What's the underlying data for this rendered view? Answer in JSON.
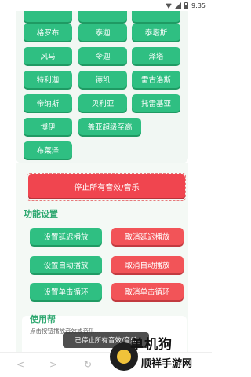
{
  "status_bar": {
    "time": "9:35",
    "icons": [
      "wifi-icon",
      "signal-icon",
      "battery-icon"
    ]
  },
  "grid_buttons": [
    {
      "label": ""
    },
    {
      "label": ""
    },
    {
      "label": ""
    },
    {
      "label": "格罗布"
    },
    {
      "label": "泰迦"
    },
    {
      "label": "泰塔斯"
    },
    {
      "label": "风马"
    },
    {
      "label": "令迦"
    },
    {
      "label": "泽塔"
    },
    {
      "label": "特利迦"
    },
    {
      "label": "德凯"
    },
    {
      "label": "雷古洛斯"
    },
    {
      "label": "帝纳斯"
    },
    {
      "label": "贝利亚"
    },
    {
      "label": "托雷基亚"
    },
    {
      "label": "博伊"
    },
    {
      "label": "盖亚超级至高"
    },
    {
      "label": "布莱泽"
    }
  ],
  "stop_all": {
    "label": "停止所有音效/音乐"
  },
  "function_settings": {
    "title": "功能设置",
    "rows": [
      {
        "set_label": "设置延迟播放",
        "cancel_label": "取消延迟播放"
      },
      {
        "set_label": "设置自动播放",
        "cancel_label": "取消自动播放"
      },
      {
        "set_label": "设置单击循环",
        "cancel_label": "取消单击循环"
      }
    ]
  },
  "help": {
    "title": "使用帮",
    "text": "点击按钮播放音效或音乐…"
  },
  "toast": {
    "message": "已停止所有音效/音乐"
  },
  "nav": {
    "back": "<",
    "forward": ">",
    "refresh": "↻",
    "home": "⌂"
  },
  "watermark": {
    "title": "单机狗",
    "sub": "顺祥手游网"
  },
  "colors": {
    "green": "#2fbf82",
    "red": "#f25458",
    "section_title": "#2fa870"
  }
}
